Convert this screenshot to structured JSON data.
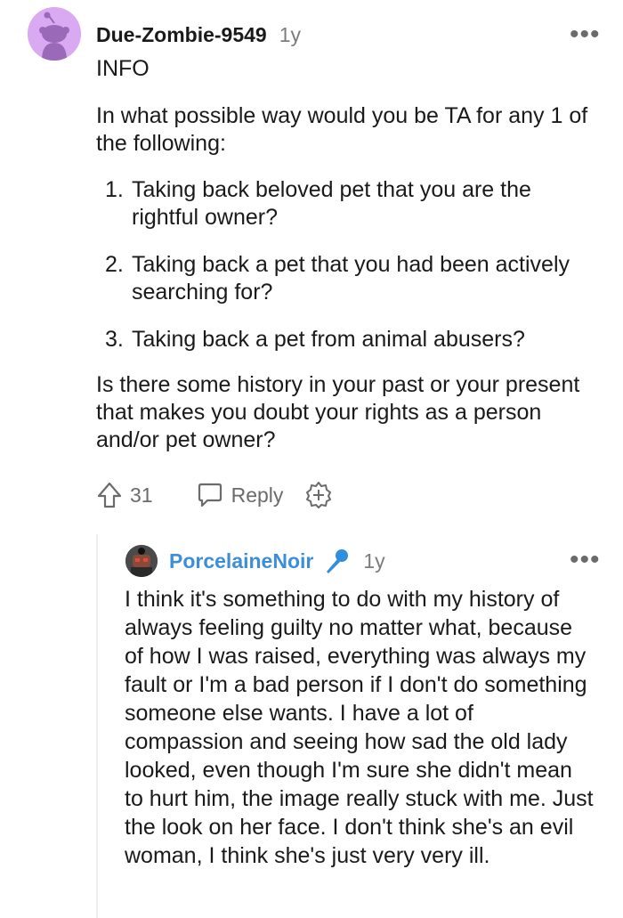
{
  "top_comment": {
    "author": "Due-Zombie-9549",
    "age": "1y",
    "more_label": "•••",
    "info": "INFO",
    "intro": "In what possible way would you be TA for any 1 of the following:",
    "list": [
      {
        "num": "1.",
        "text": "Taking back beloved pet that you are the rightful owner?"
      },
      {
        "num": "2.",
        "text": "Taking back a pet that you had been actively searching for?"
      },
      {
        "num": "3.",
        "text": "Taking back a pet from animal abusers?"
      }
    ],
    "question": "Is there some history in your past or your present that makes you doubt your rights as a person and/or pet owner?",
    "actions": {
      "upvote_count": "31",
      "reply_label": "Reply",
      "award_icon": "award-plus-icon"
    },
    "avatar_color": "#d9a9f2"
  },
  "reply_comment": {
    "author": "PorcelaineNoir",
    "author_color": "#3d8ed8",
    "flair_icon": "microphone-icon",
    "age": "1y",
    "more_label": "•••",
    "body": "I think it's something to do with my history of always feeling guilty no matter what, because of how I was raised, everything was always my fault or I'm a bad person if I don't do something someone else wants. I have a lot of compassion and seeing how sad the old lady looked, even though I'm sure she didn't mean to hurt him, the image really stuck with me. Just the look on her face. I don't think she's an evil woman, I think she's just very very ill."
  }
}
